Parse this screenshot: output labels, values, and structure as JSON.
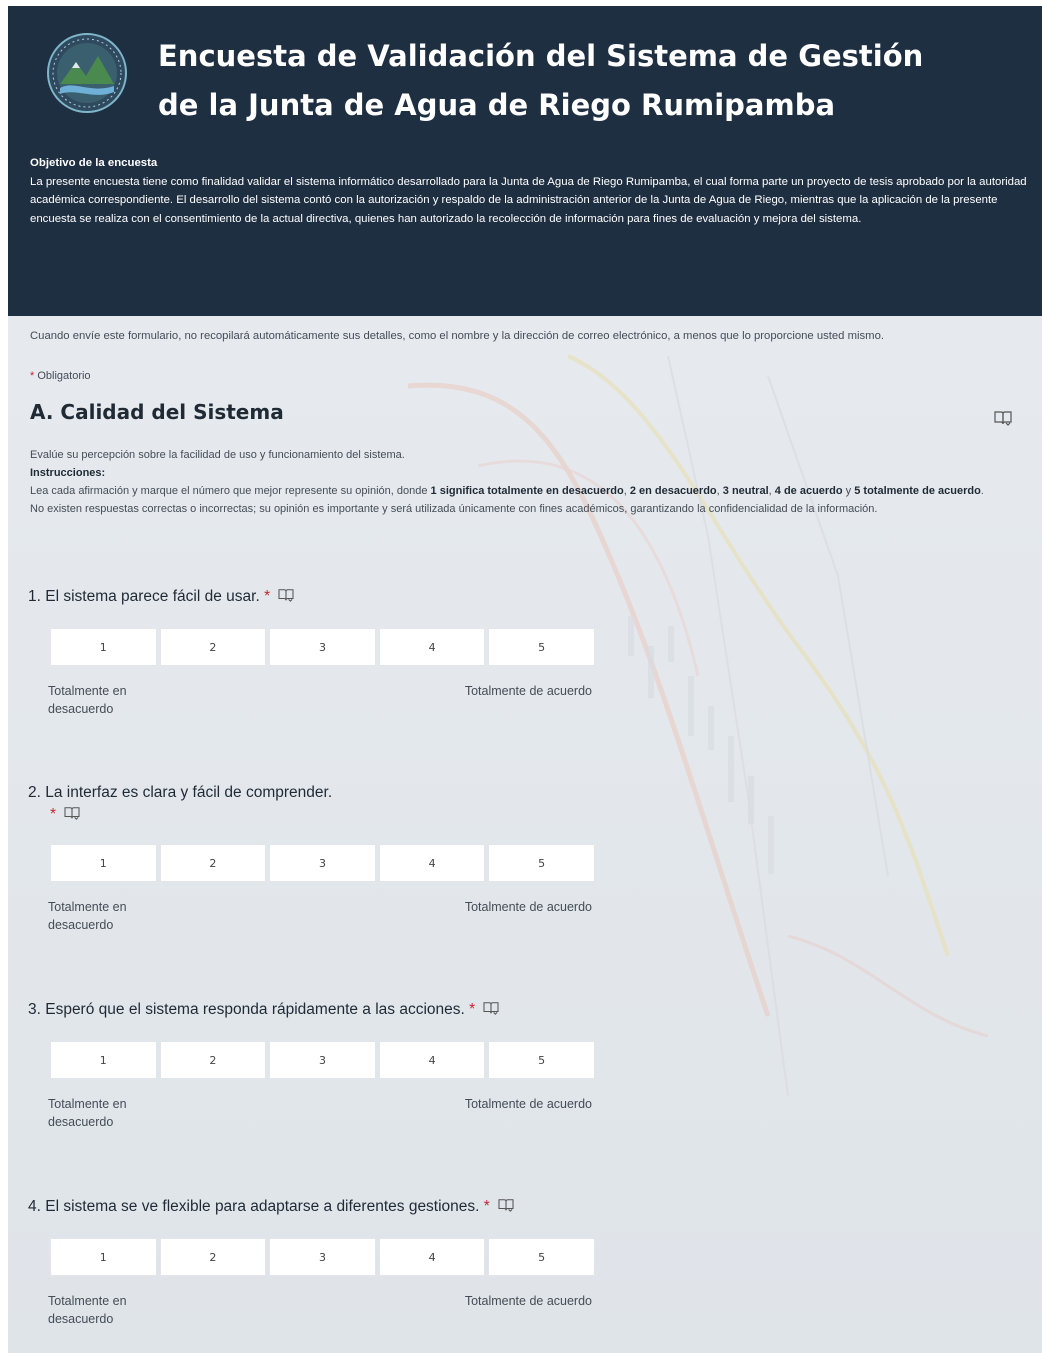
{
  "header": {
    "title_line1": "Encuesta de Validación del Sistema de Gestión",
    "title_line2": "de la Junta de Agua de Riego Rumipamba",
    "objective_title": "Objetivo de la encuesta",
    "objective_text": "La presente encuesta tiene como finalidad validar el sistema informático desarrollado para la Junta de Agua de Riego Rumipamba, el cual forma parte un proyecto de tesis aprobado por la autoridad académica correspondiente. El desarrollo del sistema contó con la autorización y respaldo de la administración anterior de la Junta de Agua de Riego, mientras que la aplicación de la presente encuesta se realiza con el consentimiento de la actual directiva, quienes han autorizado la recolección de información para fines de evaluación y mejora del sistema.",
    "brand_color": "#1f2f42"
  },
  "form": {
    "privacy_note": "Cuando envíe este formulario, no recopilará automáticamente sus detalles, como el nombre y la dirección de correo electrónico, a menos que lo proporcione usted mismo.",
    "required_star": "*",
    "required_label": "Obligatorio",
    "required_color": "#c4262e"
  },
  "section": {
    "title": "A. Calidad del Sistema",
    "intro": "Evalúe su percepción sobre la facilidad de uso y funcionamiento del sistema.",
    "instructions_label": "Instrucciones:",
    "instr_1": "Lea cada afirmación y marque el número que mejor represente su opinión, donde ",
    "instr_b1": "1 significa totalmente en desacuerdo",
    "instr_2": ", ",
    "instr_b2": "2 en desacuerdo",
    "instr_3": ", ",
    "instr_b3": "3 neutral",
    "instr_4": ", ",
    "instr_b4": "4 de acuerdo",
    "instr_5": " y ",
    "instr_b5": "5 totalmente de acuerdo",
    "instr_6": ". No existen respuestas correctas o incorrectas; su opinión es importante y será utilizada únicamente con fines académicos, garantizando la confidencialidad de la información."
  },
  "scale": {
    "options": [
      "1",
      "2",
      "3",
      "4",
      "5"
    ],
    "left_label": "Totalmente en desacuerdo",
    "right_label": "Totalmente de acuerdo"
  },
  "questions": [
    {
      "text": "1. El sistema parece fácil de usar."
    },
    {
      "text": "2. La interfaz es clara y fácil de comprender."
    },
    {
      "text": "3. Esperó que el sistema responda rápidamente a las acciones."
    },
    {
      "text": "4. El sistema se ve flexible para adaptarse a diferentes gestiones."
    }
  ]
}
